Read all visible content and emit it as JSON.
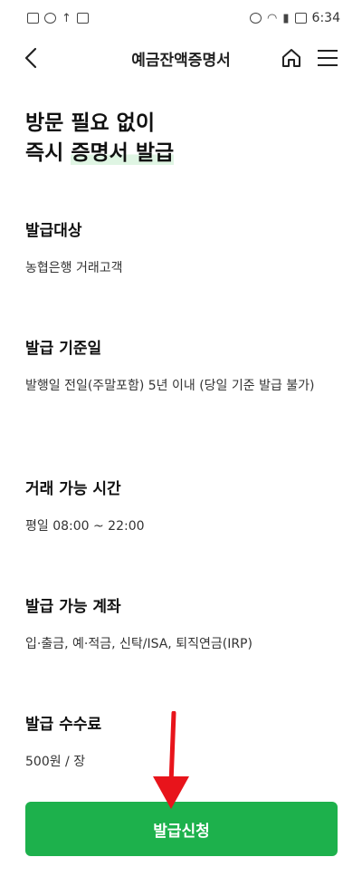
{
  "status_bar": {
    "time": "6:34"
  },
  "header": {
    "title": "예금잔액증명서",
    "back_icon": "chevron-left-icon",
    "home_icon": "home-icon",
    "menu_icon": "hamburger-menu-icon"
  },
  "headline": {
    "line1": "방문 필요 없이",
    "line2_prefix": "즉시 ",
    "line2_highlight": "증명서 발급"
  },
  "sections": [
    {
      "title": "발급대상",
      "value": "농협은행 거래고객"
    },
    {
      "title": "발급 기준일",
      "value": "발행일 전일(주말포함) 5년 이내 (당일 기준 발급 불가)"
    },
    {
      "title": "거래 가능 시간",
      "value": "평일 08:00 ~ 22:00"
    },
    {
      "title": "발급 가능 계좌",
      "value": "입·출금, 예·적금, 신탁/ISA, 퇴직연금(IRP)"
    },
    {
      "title": "발급 수수료",
      "value": "500원 / 장"
    }
  ],
  "apply_button": {
    "label": "발급신청"
  },
  "colors": {
    "primary_green": "#1db14c",
    "highlight_green": "#dff5e3",
    "annotation_red": "#e8141b"
  }
}
